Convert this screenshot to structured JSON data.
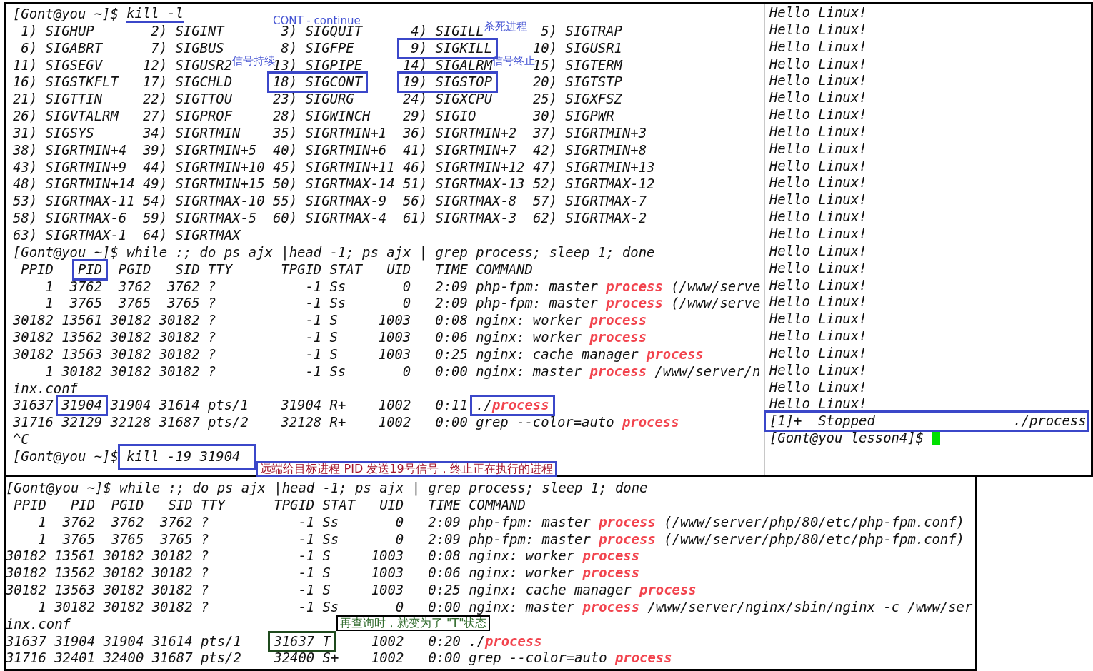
{
  "top_window": {
    "main_pane": {
      "blocks": [
        {
          "kind": "command",
          "prompt": "[Gont@you ~]$",
          "command": "kill -l",
          "underlined": true,
          "boxed": false,
          "note": {
            "kind": "label",
            "text": "CONT - continue"
          }
        },
        {
          "kind": "signals",
          "rows": [
            [
              {
                "num": "1)",
                "name": "SIGHUP",
                "boxed": false
              },
              {
                "num": "2)",
                "name": "SIGINT",
                "boxed": false
              },
              {
                "num": "3)",
                "name": "SIGQUIT",
                "boxed": false
              },
              {
                "num": "4)",
                "name": "SIGILL",
                "boxed": false,
                "note": "杀死进程"
              },
              {
                "num": "5)",
                "name": "SIGTRAP",
                "boxed": false
              }
            ],
            [
              {
                "num": "6)",
                "name": "SIGABRT",
                "boxed": false
              },
              {
                "num": "7)",
                "name": "SIGBUS",
                "boxed": false
              },
              {
                "num": "8)",
                "name": "SIGFPE",
                "boxed": false
              },
              {
                "num": "9)",
                "name": "SIGKILL",
                "boxed": true
              },
              {
                "num": "10)",
                "name": "SIGUSR1",
                "boxed": false
              }
            ],
            [
              {
                "num": "11)",
                "name": "SIGSEGV",
                "boxed": false
              },
              {
                "num": "12)",
                "name": "SIGUSR2",
                "boxed": false,
                "note": "信号持续"
              },
              {
                "num": "13)",
                "name": "SIGPIPE",
                "boxed": false
              },
              {
                "num": "14)",
                "name": "SIGALRM",
                "boxed": false,
                "note": "信号终止"
              },
              {
                "num": "15)",
                "name": "SIGTERM",
                "boxed": false
              }
            ],
            [
              {
                "num": "16)",
                "name": "SIGSTKFLT",
                "boxed": false
              },
              {
                "num": "17)",
                "name": "SIGCHLD",
                "boxed": false
              },
              {
                "num": "18)",
                "name": "SIGCONT",
                "boxed": true
              },
              {
                "num": "19)",
                "name": "SIGSTOP",
                "boxed": true
              },
              {
                "num": "20)",
                "name": "SIGTSTP",
                "boxed": false
              }
            ],
            [
              {
                "num": "21)",
                "name": "SIGTTIN",
                "boxed": false
              },
              {
                "num": "22)",
                "name": "SIGTTOU",
                "boxed": false
              },
              {
                "num": "23)",
                "name": "SIGURG",
                "boxed": false
              },
              {
                "num": "24)",
                "name": "SIGXCPU",
                "boxed": false
              },
              {
                "num": "25)",
                "name": "SIGXFSZ",
                "boxed": false
              }
            ],
            [
              {
                "num": "26)",
                "name": "SIGVTALRM",
                "boxed": false
              },
              {
                "num": "27)",
                "name": "SIGPROF",
                "boxed": false
              },
              {
                "num": "28)",
                "name": "SIGWINCH",
                "boxed": false
              },
              {
                "num": "29)",
                "name": "SIGIO",
                "boxed": false
              },
              {
                "num": "30)",
                "name": "SIGPWR",
                "boxed": false
              }
            ],
            [
              {
                "num": "31)",
                "name": "SIGSYS",
                "boxed": false
              },
              {
                "num": "34)",
                "name": "SIGRTMIN",
                "boxed": false
              },
              {
                "num": "35)",
                "name": "SIGRTMIN+1",
                "boxed": false
              },
              {
                "num": "36)",
                "name": "SIGRTMIN+2",
                "boxed": false
              },
              {
                "num": "37)",
                "name": "SIGRTMIN+3",
                "boxed": false
              }
            ],
            [
              {
                "num": "38)",
                "name": "SIGRTMIN+4",
                "boxed": false
              },
              {
                "num": "39)",
                "name": "SIGRTMIN+5",
                "boxed": false
              },
              {
                "num": "40)",
                "name": "SIGRTMIN+6",
                "boxed": false
              },
              {
                "num": "41)",
                "name": "SIGRTMIN+7",
                "boxed": false
              },
              {
                "num": "42)",
                "name": "SIGRTMIN+8",
                "boxed": false
              }
            ],
            [
              {
                "num": "43)",
                "name": "SIGRTMIN+9",
                "boxed": false
              },
              {
                "num": "44)",
                "name": "SIGRTMIN+10",
                "boxed": false
              },
              {
                "num": "45)",
                "name": "SIGRTMIN+11",
                "boxed": false
              },
              {
                "num": "46)",
                "name": "SIGRTMIN+12",
                "boxed": false
              },
              {
                "num": "47)",
                "name": "SIGRTMIN+13",
                "boxed": false
              }
            ],
            [
              {
                "num": "48)",
                "name": "SIGRTMIN+14",
                "boxed": false
              },
              {
                "num": "49)",
                "name": "SIGRTMIN+15",
                "boxed": false
              },
              {
                "num": "50)",
                "name": "SIGRTMAX-14",
                "boxed": false
              },
              {
                "num": "51)",
                "name": "SIGRTMAX-13",
                "boxed": false
              },
              {
                "num": "52)",
                "name": "SIGRTMAX-12",
                "boxed": false
              }
            ],
            [
              {
                "num": "53)",
                "name": "SIGRTMAX-11",
                "boxed": false
              },
              {
                "num": "54)",
                "name": "SIGRTMAX-10",
                "boxed": false
              },
              {
                "num": "55)",
                "name": "SIGRTMAX-9",
                "boxed": false
              },
              {
                "num": "56)",
                "name": "SIGRTMAX-8",
                "boxed": false
              },
              {
                "num": "57)",
                "name": "SIGRTMAX-7",
                "boxed": false
              }
            ],
            [
              {
                "num": "58)",
                "name": "SIGRTMAX-6",
                "boxed": false
              },
              {
                "num": "59)",
                "name": "SIGRTMAX-5",
                "boxed": false
              },
              {
                "num": "60)",
                "name": "SIGRTMAX-4",
                "boxed": false
              },
              {
                "num": "61)",
                "name": "SIGRTMAX-3",
                "boxed": false
              },
              {
                "num": "62)",
                "name": "SIGRTMAX-2",
                "boxed": false
              }
            ],
            [
              {
                "num": "63)",
                "name": "SIGRTMAX-1",
                "boxed": false
              },
              {
                "num": "64)",
                "name": "SIGRTMAX",
                "boxed": false
              }
            ]
          ]
        },
        {
          "kind": "command",
          "prompt": "[Gont@you ~]$",
          "command": "while :; do ps ajx |head -1; ps ajx | grep process; sleep 1; done",
          "underlined": false,
          "boxed": false
        },
        {
          "kind": "ps",
          "columns": [
            {
              "label": "PPID",
              "boxed": false
            },
            {
              "label": "PID",
              "boxed": true
            },
            {
              "label": "PGID",
              "boxed": false
            },
            {
              "label": "SID",
              "boxed": false
            },
            {
              "label": "TTY",
              "boxed": false
            },
            {
              "label": "TPGID",
              "boxed": false
            },
            {
              "label": "STAT",
              "boxed": false
            },
            {
              "label": "UID",
              "boxed": false
            },
            {
              "label": "TIME",
              "boxed": false
            },
            {
              "label": "COMMAND",
              "boxed": false
            }
          ],
          "rows": [
            {
              "kind": "process",
              "cells": [
                "1",
                "3762",
                "3762",
                "3762",
                "?",
                "-1",
                "Ss",
                "0",
                "2:09",
                "php-fpm: master **process** (/www/serve"
              ],
              "boxed": [
                false,
                false,
                false,
                false,
                false,
                false,
                false,
                false,
                false,
                false
              ]
            },
            {
              "kind": "process",
              "cells": [
                "1",
                "3765",
                "3765",
                "3765",
                "?",
                "-1",
                "Ss",
                "0",
                "2:09",
                "php-fpm: master **process** (/www/serve"
              ],
              "boxed": [
                false,
                false,
                false,
                false,
                false,
                false,
                false,
                false,
                false,
                false
              ]
            },
            {
              "kind": "process",
              "cells": [
                "30182",
                "13561",
                "30182",
                "30182",
                "?",
                "-1",
                "S",
                "1003",
                "0:08",
                "nginx: worker **process**"
              ],
              "boxed": [
                false,
                false,
                false,
                false,
                false,
                false,
                false,
                false,
                false,
                false
              ]
            },
            {
              "kind": "process",
              "cells": [
                "30182",
                "13562",
                "30182",
                "30182",
                "?",
                "-1",
                "S",
                "1003",
                "0:06",
                "nginx: worker **process**"
              ],
              "boxed": [
                false,
                false,
                false,
                false,
                false,
                false,
                false,
                false,
                false,
                false
              ]
            },
            {
              "kind": "process",
              "cells": [
                "30182",
                "13563",
                "30182",
                "30182",
                "?",
                "-1",
                "S",
                "1003",
                "0:25",
                "nginx: cache manager **process**"
              ],
              "boxed": [
                false,
                false,
                false,
                false,
                false,
                false,
                false,
                false,
                false,
                false
              ]
            },
            {
              "kind": "process",
              "cells": [
                "1",
                "30182",
                "30182",
                "30182",
                "?",
                "-1",
                "Ss",
                "0",
                "0:00",
                "nginx: master **process** /www/server/n"
              ],
              "boxed": [
                false,
                false,
                false,
                false,
                false,
                false,
                false,
                false,
                false,
                false
              ]
            },
            {
              "kind": "wrap",
              "text": "inx.conf"
            },
            {
              "kind": "process",
              "cells": [
                "31637",
                "31904",
                "31904",
                "31614",
                "pts/1",
                "31904",
                "R+",
                "1002",
                "0:11",
                "./**process**"
              ],
              "boxed": [
                false,
                true,
                false,
                false,
                false,
                false,
                false,
                false,
                false,
                true
              ]
            },
            {
              "kind": "process",
              "cells": [
                "31716",
                "32129",
                "32128",
                "31687",
                "pts/2",
                "32128",
                "R+",
                "1002",
                "0:00",
                "grep --color=auto **process**"
              ],
              "boxed": [
                false,
                false,
                false,
                false,
                false,
                false,
                false,
                false,
                false,
                false
              ]
            }
          ]
        },
        {
          "kind": "output",
          "text": "^C"
        },
        {
          "kind": "command",
          "prompt": "[Gont@you ~]$",
          "command": "kill -19 31904",
          "underlined": false,
          "boxed": true,
          "note": {
            "kind": "callout",
            "text": "远端给目标进程 PID 发送19号信号，终止正在执行的进程"
          }
        }
      ]
    },
    "side_pane": {
      "lines": [
        "Hello Linux!",
        "Hello Linux!",
        "Hello Linux!",
        "Hello Linux!",
        "Hello Linux!",
        "Hello Linux!",
        "Hello Linux!",
        "Hello Linux!",
        "Hello Linux!",
        "Hello Linux!",
        "Hello Linux!",
        "Hello Linux!",
        "Hello Linux!",
        "Hello Linux!",
        "Hello Linux!",
        "Hello Linux!",
        "Hello Linux!",
        "Hello Linux!",
        "Hello Linux!",
        "Hello Linux!",
        "Hello Linux!",
        "Hello Linux!",
        "Hello Linux!",
        "Hello Linux!"
      ],
      "job": {
        "text": "[1]+  Stopped                 ./process",
        "boxed": true
      },
      "prompt": "[Gont@you lesson4]$",
      "cursor": true
    }
  },
  "bottom_window": {
    "blocks": [
      {
        "kind": "command",
        "prompt": "[Gont@you ~]$",
        "command": "while :; do ps ajx |head -1; ps ajx | grep process; sleep 1; done",
        "underlined": false,
        "boxed": false
      },
      {
        "kind": "ps",
        "columns": [
          {
            "label": "PPID",
            "boxed": false
          },
          {
            "label": "PID",
            "boxed": false
          },
          {
            "label": "PGID",
            "boxed": false
          },
          {
            "label": "SID",
            "boxed": false
          },
          {
            "label": "TTY",
            "boxed": false
          },
          {
            "label": "TPGID",
            "boxed": false
          },
          {
            "label": "STAT",
            "boxed": false
          },
          {
            "label": "UID",
            "boxed": false
          },
          {
            "label": "TIME",
            "boxed": false
          },
          {
            "label": "COMMAND",
            "boxed": false
          }
        ],
        "rows": [
          {
            "kind": "process",
            "cells": [
              "1",
              "3762",
              "3762",
              "3762",
              "?",
              "-1",
              "Ss",
              "0",
              "2:09",
              "php-fpm: master **process** (/www/server/php/80/etc/php-fpm.conf)"
            ],
            "boxed": [
              false,
              false,
              false,
              false,
              false,
              false,
              false,
              false,
              false,
              false
            ]
          },
          {
            "kind": "process",
            "cells": [
              "1",
              "3765",
              "3765",
              "3765",
              "?",
              "-1",
              "Ss",
              "0",
              "2:09",
              "php-fpm: master **process** (/www/server/php/80/etc/php-fpm.conf)"
            ],
            "boxed": [
              false,
              false,
              false,
              false,
              false,
              false,
              false,
              false,
              false,
              false
            ]
          },
          {
            "kind": "process",
            "cells": [
              "30182",
              "13561",
              "30182",
              "30182",
              "?",
              "-1",
              "S",
              "1003",
              "0:08",
              "nginx: worker **process**"
            ],
            "boxed": [
              false,
              false,
              false,
              false,
              false,
              false,
              false,
              false,
              false,
              false
            ]
          },
          {
            "kind": "process",
            "cells": [
              "30182",
              "13562",
              "30182",
              "30182",
              "?",
              "-1",
              "S",
              "1003",
              "0:06",
              "nginx: worker **process**"
            ],
            "boxed": [
              false,
              false,
              false,
              false,
              false,
              false,
              false,
              false,
              false,
              false
            ]
          },
          {
            "kind": "process",
            "cells": [
              "30182",
              "13563",
              "30182",
              "30182",
              "?",
              "-1",
              "S",
              "1003",
              "0:25",
              "nginx: cache manager **process**"
            ],
            "boxed": [
              false,
              false,
              false,
              false,
              false,
              false,
              false,
              false,
              false,
              false
            ]
          },
          {
            "kind": "process",
            "cells": [
              "1",
              "30182",
              "30182",
              "30182",
              "?",
              "-1",
              "Ss",
              "0",
              "0:00",
              "nginx: master **process** /www/server/nginx/sbin/nginx -c /www/ser"
            ],
            "boxed": [
              false,
              false,
              false,
              false,
              false,
              false,
              false,
              false,
              false,
              false
            ]
          },
          {
            "kind": "wrap",
            "text": "inx.conf"
          },
          {
            "kind": "process",
            "cells": [
              "31637",
              "31904",
              "31904",
              "31614",
              "pts/1",
              "31637",
              "T",
              "1002",
              "0:20",
              "./**process**"
            ],
            "boxed": [
              false,
              false,
              false,
              false,
              false,
              true,
              true,
              false,
              false,
              false
            ],
            "note": "再查询时，就变为了 \"T\"状态"
          },
          {
            "kind": "process",
            "cells": [
              "31716",
              "32401",
              "32400",
              "31687",
              "pts/2",
              "32400",
              "S+",
              "1002",
              "0:00",
              "grep --color=auto **process**"
            ],
            "boxed": [
              false,
              false,
              false,
              false,
              false,
              false,
              false,
              false,
              false,
              false
            ]
          }
        ]
      }
    ]
  }
}
